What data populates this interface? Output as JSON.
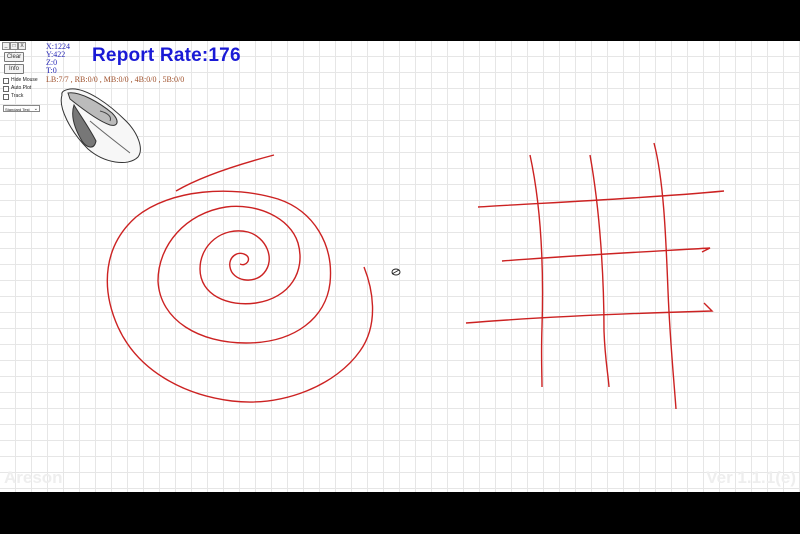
{
  "window_controls": [
    "_",
    "□",
    "X"
  ],
  "controls": {
    "clear_label": "Clear",
    "info_label": "Info",
    "hide_mouse_label": "Hide Mouse",
    "auto_plot_label": "Auto Plot",
    "track_label": "Track",
    "mode_select_value": "Standard Test"
  },
  "readout": {
    "x": "X:1224",
    "y": "Y:422",
    "z": "Z:0",
    "t": "T:0",
    "buttons": "LB:7/7 , RB:0/0 , MB:0/0 , 4B:0/0 , 5B:0/0"
  },
  "report_rate": "Report Rate:176",
  "brand": "Areson",
  "version": "Ver 1.1.1(e)",
  "colors": {
    "stroke": "#cc2222",
    "report_rate": "#1a1ad6",
    "coords": "#2a2ab8",
    "button_counts": "#a0522d"
  },
  "icons": {
    "mouse": "mouse-illustration-icon",
    "cursor": "cursor-icon"
  }
}
